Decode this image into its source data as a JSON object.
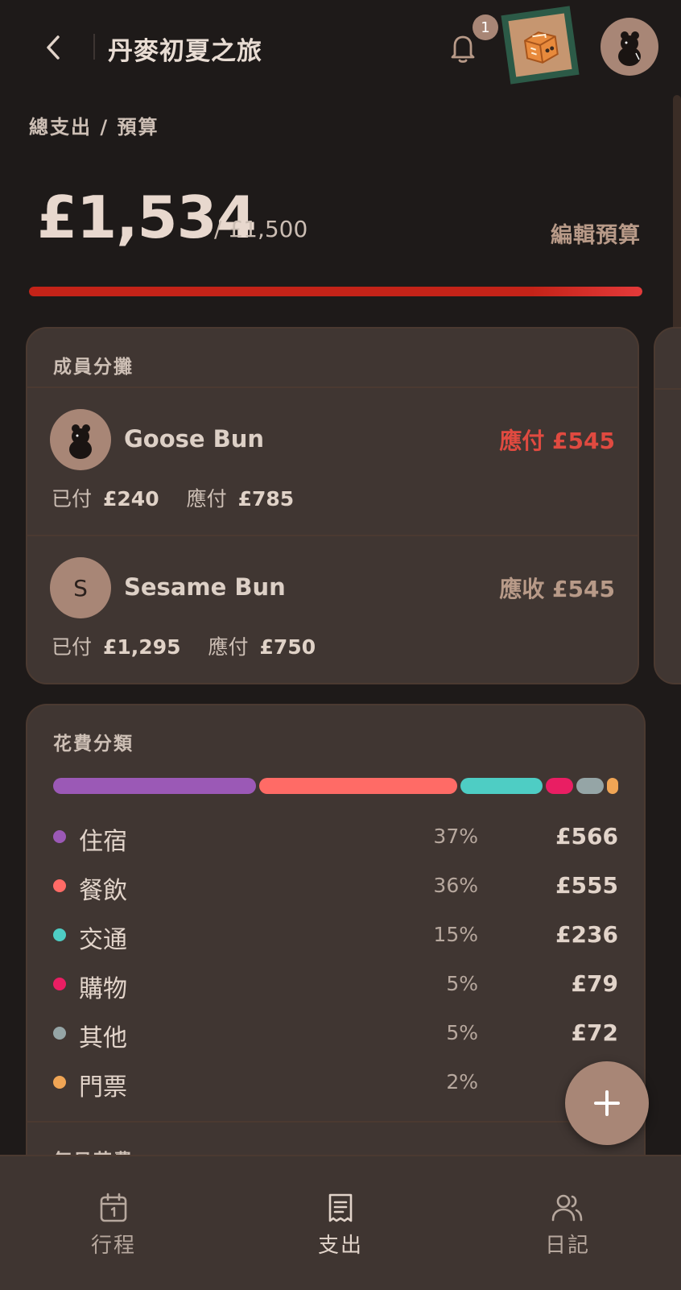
{
  "header": {
    "title": "丹麥初夏之旅",
    "notification_count": "1"
  },
  "summary": {
    "label": "總支出 / 預算",
    "total": "£1,534",
    "budget": "/ £1,500",
    "edit_label": "編輯預算",
    "progress_percent": 100
  },
  "members": {
    "title": "成員分攤",
    "items": [
      {
        "name": "Goose Bun",
        "avatar": "bear-photo",
        "status": "應付 £545",
        "paid_label": "已付",
        "paid": "£240",
        "owed_label": "應付",
        "owed": "£785"
      },
      {
        "name": "Sesame Bun",
        "avatar_letter": "S",
        "status": "應收 £545",
        "paid_label": "已付",
        "paid": "£1,295",
        "owed_label": "應付",
        "owed": "£750"
      }
    ]
  },
  "categories": {
    "title": "花費分類",
    "items": [
      {
        "name": "住宿",
        "percent": "37%",
        "amount": "£566",
        "color": "#9b59b6"
      },
      {
        "name": "餐飲",
        "percent": "36%",
        "amount": "£555",
        "color": "#ff6b66"
      },
      {
        "name": "交通",
        "percent": "15%",
        "amount": "£236",
        "color": "#4ecdc4"
      },
      {
        "name": "購物",
        "percent": "5%",
        "amount": "£79",
        "color": "#e91e63"
      },
      {
        "name": "其他",
        "percent": "5%",
        "amount": "£72",
        "color": "#95a5a6"
      },
      {
        "name": "門票",
        "percent": "2%",
        "amount": "",
        "color": "#f0a555"
      }
    ]
  },
  "daily": {
    "title": "每日花費"
  },
  "nav": {
    "items": [
      {
        "label": "行程",
        "icon": "calendar-icon"
      },
      {
        "label": "支出",
        "icon": "receipt-icon"
      },
      {
        "label": "日記",
        "icon": "users-icon"
      }
    ],
    "active": "支出"
  },
  "colors": {
    "background": "#1e1a19",
    "card": "#403632",
    "accent": "#a88676",
    "danger": "#e04a40",
    "progress": "#c42318"
  }
}
